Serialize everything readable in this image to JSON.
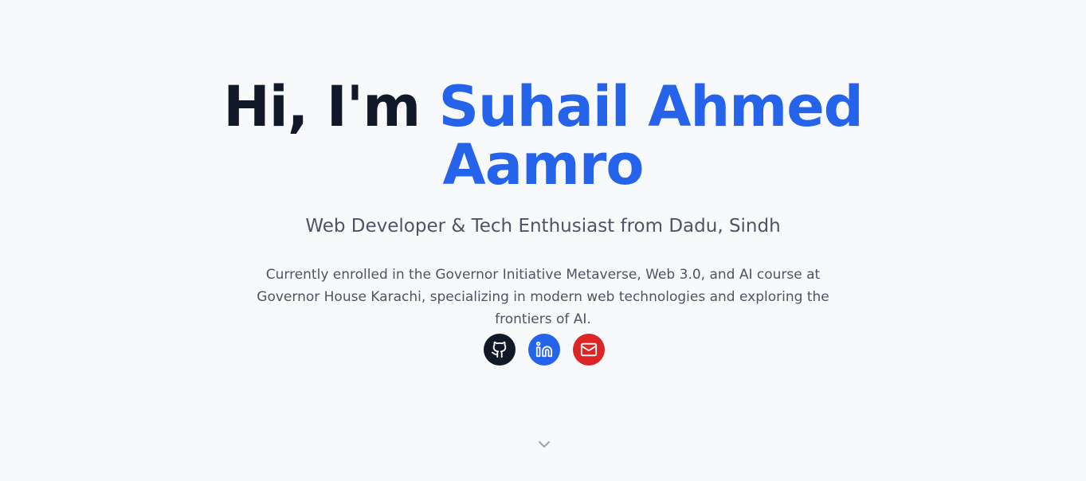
{
  "hero": {
    "greeting": "Hi, I'm",
    "name_line1": "Suhail Ahmed",
    "name_line2": "Aamro",
    "subtitle": "Web Developer & Tech Enthusiast from Dadu, Sindh",
    "description": "Currently enrolled in the Governor Initiative Metaverse, Web 3.0, and AI course at Governor House Karachi, specializing in modern web technologies and exploring the frontiers of AI."
  },
  "socials": [
    {
      "icon": "github-icon",
      "color": "#111827"
    },
    {
      "icon": "linkedin-icon",
      "color": "#2563eb"
    },
    {
      "icon": "mail-icon",
      "color": "#dc2626"
    }
  ],
  "scroll": {
    "icon": "chevron-down-icon",
    "color": "#9ca3af"
  },
  "colors": {
    "background": "#f8f9fb",
    "heading": "#111827",
    "accent": "#2563eb",
    "body_text": "#4b5563"
  }
}
